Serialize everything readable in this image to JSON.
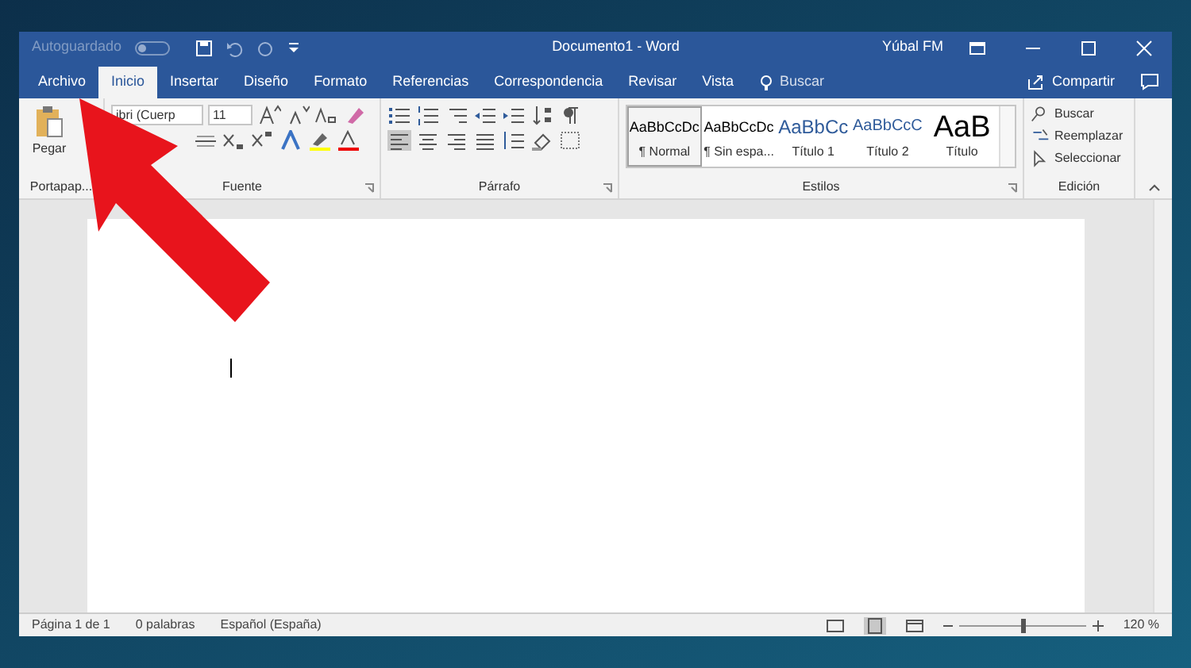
{
  "title_bar": {
    "autosave_label": "Autoguardado",
    "autosave_on": false,
    "title": "Documento1 - Word",
    "user": "Yúbal FM"
  },
  "tabs": [
    {
      "label": "Archivo",
      "selected": false
    },
    {
      "label": "Inicio",
      "selected": true
    },
    {
      "label": "Insertar",
      "selected": false
    },
    {
      "label": "Diseño",
      "selected": false
    },
    {
      "label": "Formato",
      "selected": false
    },
    {
      "label": "Referencias",
      "selected": false
    },
    {
      "label": "Correspondencia",
      "selected": false
    },
    {
      "label": "Revisar",
      "selected": false
    },
    {
      "label": "Vista",
      "selected": false
    }
  ],
  "tell_me": {
    "placeholder": "Buscar"
  },
  "share": "Compartir",
  "ribbon": {
    "clipboard": {
      "paste": "Pegar",
      "label": "Portapap..."
    },
    "font": {
      "font_name": "ibri (Cuerp",
      "font_size": "11",
      "label": "Fuente"
    },
    "paragraph": {
      "label": "Párrafo"
    },
    "styles": {
      "items": [
        {
          "preview": "AaBbCcDc",
          "name": "¶ Normal",
          "selected": true,
          "kind": "body"
        },
        {
          "preview": "AaBbCcDc",
          "name": "¶ Sin espa...",
          "selected": false,
          "kind": "body"
        },
        {
          "preview": "AaBbCc",
          "name": "Título 1",
          "selected": false,
          "kind": "heading"
        },
        {
          "preview": "AaBbCcC",
          "name": "Título 2",
          "selected": false,
          "kind": "heading2"
        },
        {
          "preview": "AaB",
          "name": "Título",
          "selected": false,
          "kind": "title"
        }
      ],
      "label": "Estilos"
    },
    "editing": {
      "items": [
        "Buscar",
        "Reemplazar",
        "Seleccionar"
      ],
      "label": "Edición"
    }
  },
  "status_bar": {
    "page": "Página 1 de 1",
    "words": "0 palabras",
    "language": "Español (España)",
    "zoom": {
      "level": 0.5
    },
    "zoom_label": "120 %"
  }
}
